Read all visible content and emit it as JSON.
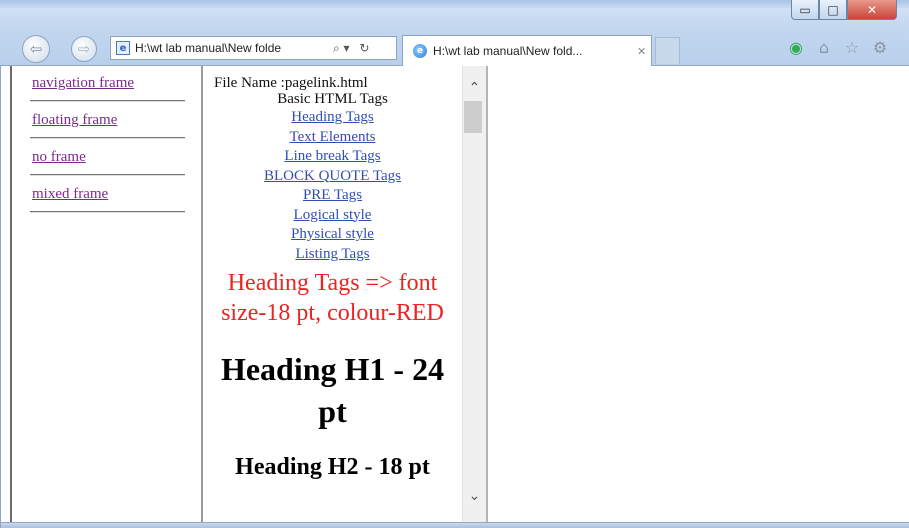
{
  "window": {
    "minimize_glyph": "▭",
    "maximize_glyph": "□",
    "close_glyph": "✕"
  },
  "browser": {
    "back_glyph": "⇦",
    "forward_glyph": "⇨",
    "address": "H:\\wt lab manual\\New folde",
    "address_icons": [
      "⌕ ▾",
      "↻"
    ],
    "tab_title": "H:\\wt lab manual\\New fold...",
    "tab_close": "✕",
    "toolbar_icons": [
      "home-icon",
      "star-icon",
      "gear-icon"
    ],
    "toolbar_glyphs": {
      "addon": "◉",
      "home": "⌂",
      "star": "☆",
      "gear": "⚙"
    }
  },
  "left_frame": {
    "links": [
      {
        "label": "navigation frame"
      },
      {
        "label": "floating frame"
      },
      {
        "label": "no frame"
      },
      {
        "label": "mixed frame"
      }
    ]
  },
  "middle_frame": {
    "file_name": "File Name :pagelink.html",
    "basic_title": "Basic HTML Tags",
    "links": [
      {
        "label": "Heading Tags"
      },
      {
        "label": "Text Elements"
      },
      {
        "label": "Line break Tags"
      },
      {
        "label": "BLOCK QUOTE Tags"
      },
      {
        "label": "PRE Tags"
      },
      {
        "label": "Logical style"
      },
      {
        "label": "Physical style"
      },
      {
        "label": "Listing Tags"
      }
    ],
    "red_heading": "Heading Tags => font size-18 pt, colour-RED",
    "h1_text": "Heading H1 - 24 pt",
    "h2_text": "Heading H2 - 18 pt",
    "scroll_up_glyph": "⌃",
    "scroll_down_glyph": "⌄"
  },
  "colors": {
    "visited_link": "#7b2c8a",
    "link": "#2f4fb3",
    "red_heading": "#ee2222"
  }
}
